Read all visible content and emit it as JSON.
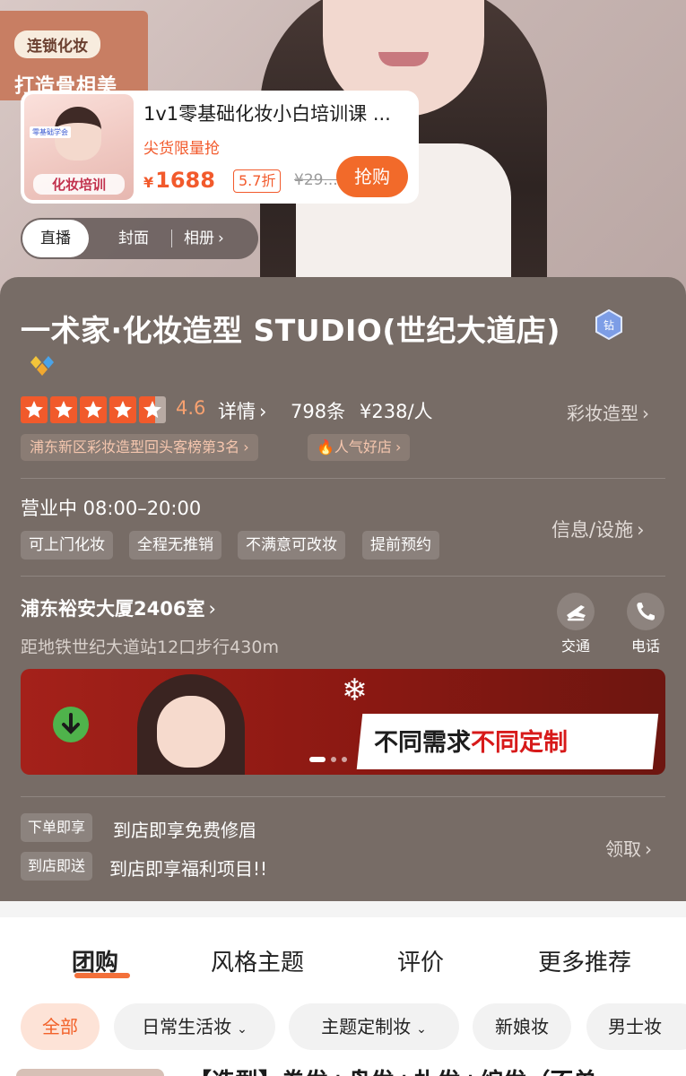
{
  "hero": {
    "stamp_top": "连锁化妆",
    "stamp_bottom": "打造骨相美",
    "product": {
      "thumb_tag": "零基础学会",
      "thumb_label": "化妆培训",
      "title": "1v1零基础化妆小白培训课 ...",
      "subtitle": "尖货限量抢",
      "currency": "¥",
      "price": "1688",
      "discount": "5.7折",
      "original_price": "¥29...",
      "buy_label": "抢购"
    },
    "media_tabs": [
      "直播",
      "封面",
      "相册"
    ]
  },
  "shop": {
    "title": "一术家·化妆造型 STUDIO(世纪大道店)",
    "rating": {
      "stars": 4.6,
      "value": "4.6",
      "detail": "详情",
      "count": "798条",
      "price_per_person": "¥238/人"
    },
    "category": "彩妆造型",
    "rank_chip": "浦东新区彩妆造型回头客榜第3名",
    "popular_chip": "人气好店",
    "hours": "营业中 08:00–20:00",
    "services": [
      "可上门化妆",
      "全程无推销",
      "不满意可改妆",
      "提前预约"
    ],
    "facility_link": "信息/设施",
    "address": "浦东裕安大厦2406室",
    "distance": "距地铁世纪大道站12口步行430m",
    "actions": [
      {
        "label": "交通",
        "icon": "transport-icon"
      },
      {
        "label": "电话",
        "icon": "phone-icon"
      }
    ],
    "banner": {
      "text_plain": "不同需求",
      "text_highlight": "不同定制"
    },
    "promos": [
      {
        "tag": "下单即享",
        "text": "到店即享免费修眉"
      },
      {
        "tag": "到店即送",
        "text": "到店即享福利项目!!"
      }
    ],
    "claim": "领取"
  },
  "tabs": [
    "团购",
    "风格主题",
    "评价",
    "更多推荐"
  ],
  "filters": [
    {
      "label": "全部",
      "dropdown": false
    },
    {
      "label": "日常生活妆",
      "dropdown": true
    },
    {
      "label": "主题定制妆",
      "dropdown": true
    },
    {
      "label": "新娘妆",
      "dropdown": false
    },
    {
      "label": "男士妆",
      "dropdown": false
    }
  ],
  "next_item_title": "【造型】卷发+盘发+扎发+编发（不单",
  "colors": {
    "accent": "#f25a2c",
    "panel": "#776c66",
    "tab_underline": "#f3703a",
    "filter_active_bg": "#fde3d7"
  }
}
